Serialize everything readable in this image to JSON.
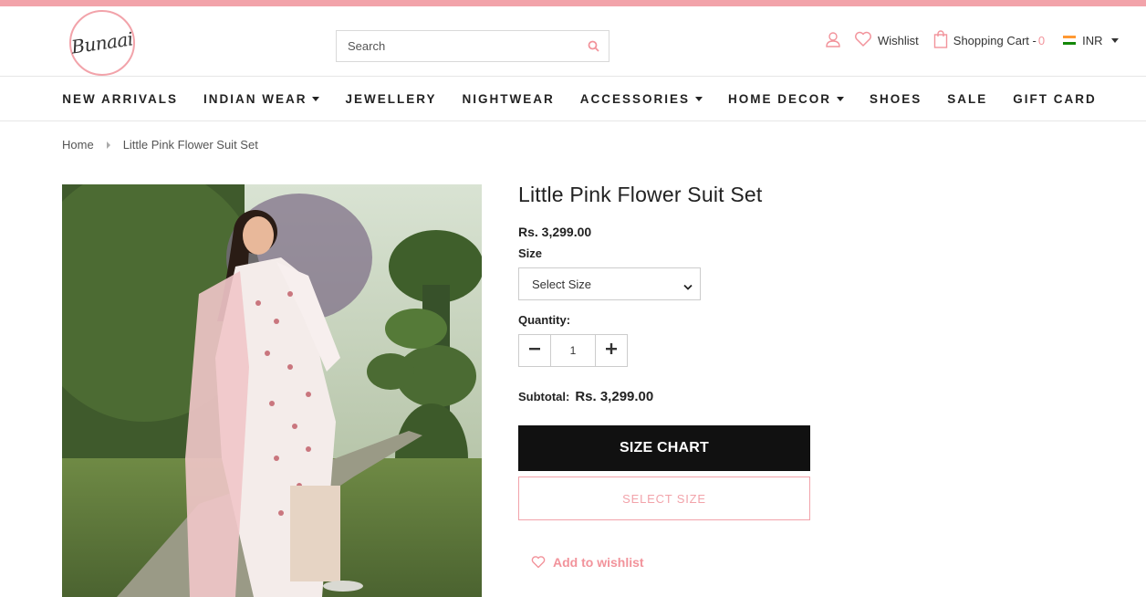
{
  "brand": {
    "logo_text": "Bunaai"
  },
  "search": {
    "placeholder": "Search"
  },
  "header": {
    "wishlist_label": "Wishlist",
    "cart_label": "Shopping Cart -",
    "cart_count": "0",
    "currency": "INR"
  },
  "nav": {
    "items": [
      {
        "label": "NEW ARRIVALS"
      },
      {
        "label": "INDIAN WEAR"
      },
      {
        "label": "JEWELLERY"
      },
      {
        "label": "NIGHTWEAR"
      },
      {
        "label": "ACCESSORIES"
      },
      {
        "label": "HOME DECOR"
      },
      {
        "label": "SHOES"
      },
      {
        "label": "SALE"
      },
      {
        "label": "GIFT CARD"
      }
    ]
  },
  "breadcrumb": {
    "home": "Home",
    "current": "Little Pink Flower Suit Set"
  },
  "product": {
    "title": "Little Pink Flower Suit Set",
    "price": "Rs. 3,299.00",
    "size_label": "Size",
    "size_selected": "Select Size",
    "quantity_label": "Quantity:",
    "quantity": "1",
    "subtotal_label": "Subtotal:",
    "subtotal_value": "Rs. 3,299.00",
    "size_chart_button": "SIZE CHART",
    "select_size_button": "SELECT SIZE",
    "add_to_wishlist": "Add to wishlist"
  },
  "colors": {
    "accent": "#f2a3aa",
    "accent_text": "#f2939b",
    "dark": "#111111"
  }
}
